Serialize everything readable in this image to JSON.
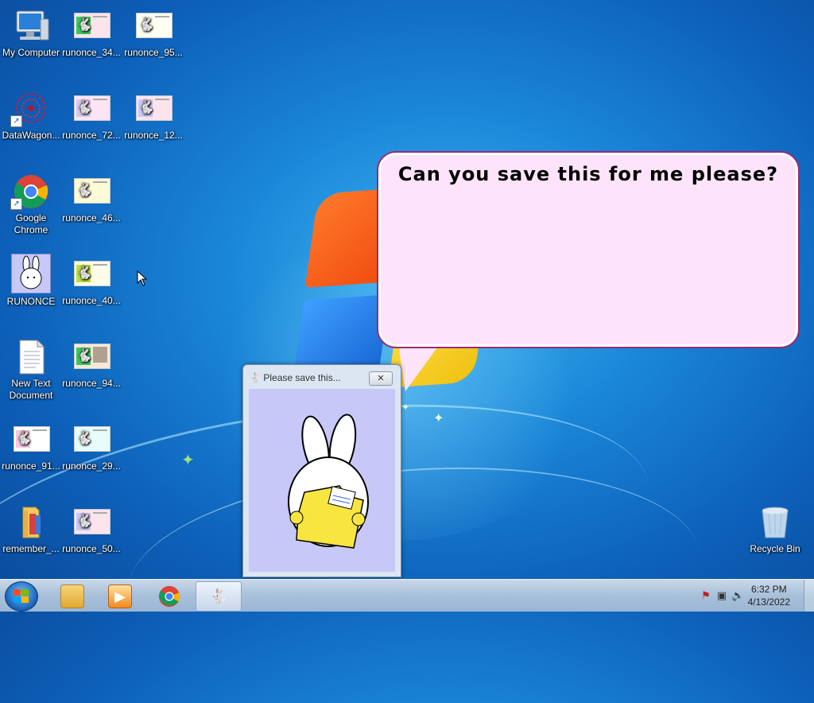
{
  "desktop": {
    "icons": [
      {
        "label": "My Computer",
        "kind": "computer"
      },
      {
        "label": "runonce_34...",
        "kind": "thumb"
      },
      {
        "label": "runonce_95...",
        "kind": "thumb"
      },
      {
        "label": "DataWagon...",
        "kind": "datawagon"
      },
      {
        "label": "runonce_72...",
        "kind": "thumb"
      },
      {
        "label": "runonce_12...",
        "kind": "thumb"
      },
      {
        "label": "Google Chrome",
        "kind": "chrome"
      },
      {
        "label": "runonce_46...",
        "kind": "thumb"
      },
      {
        "label": "RUNONCE",
        "kind": "bunny"
      },
      {
        "label": "runonce_40...",
        "kind": "thumb"
      },
      {
        "label": "New Text Document",
        "kind": "text"
      },
      {
        "label": "runonce_94...",
        "kind": "thumb"
      },
      {
        "label": "runonce_91...",
        "kind": "thumb"
      },
      {
        "label": "runonce_29...",
        "kind": "thumb"
      },
      {
        "label": "remember_...",
        "kind": "folder"
      },
      {
        "label": "runonce_50...",
        "kind": "thumb"
      },
      {
        "label": "Recycle Bin",
        "kind": "recycle"
      }
    ]
  },
  "bubble": {
    "text": "Can you save this for me please?"
  },
  "dialog": {
    "title": "Please save this...",
    "close_glyph": "✕"
  },
  "taskbar": {
    "clock_time": "6:32 PM",
    "clock_date": "4/13/2022"
  },
  "colors": {
    "bubble_bg": "#fde4fa",
    "dialog_body": "#c8c8f8",
    "desktop_blue": "#1a86d8"
  }
}
